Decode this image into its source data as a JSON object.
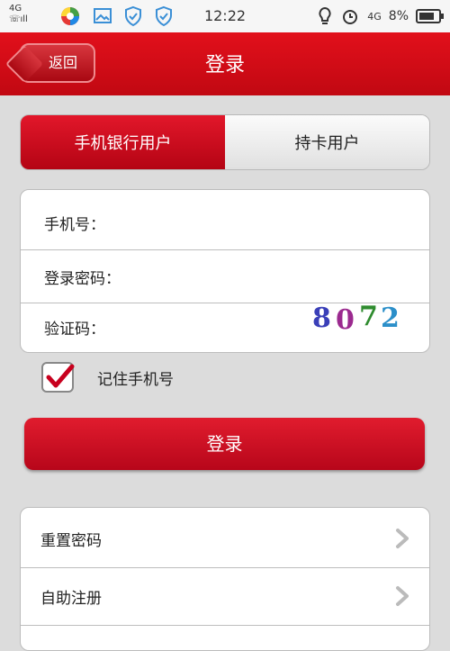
{
  "status_bar": {
    "network_top": "4G",
    "time": "12:22",
    "network_right": "4G",
    "battery": "8%"
  },
  "header": {
    "back_label": "返回",
    "title": "登录"
  },
  "tabs": [
    {
      "label": "手机银行用户",
      "active": true
    },
    {
      "label": "持卡用户",
      "active": false
    }
  ],
  "form": {
    "phone_label": "手机号：",
    "phone_value": "",
    "password_label": "登录密码：",
    "password_value": "",
    "captcha_label": "验证码：",
    "captcha_value": "",
    "captcha_code": [
      "8",
      "0",
      "7",
      "2"
    ],
    "captcha_colors": [
      "#3a3fb8",
      "#9b2a8f",
      "#2e8b2e",
      "#2c8fc9"
    ]
  },
  "remember": {
    "label": "记住手机号",
    "checked": true,
    "check_color": "#c8001e"
  },
  "login_button": "登录",
  "menu": [
    {
      "label": "重置密码"
    },
    {
      "label": "自助注册"
    }
  ],
  "colors": {
    "brand_red": "#d4101c",
    "background": "#dcdcdc"
  }
}
